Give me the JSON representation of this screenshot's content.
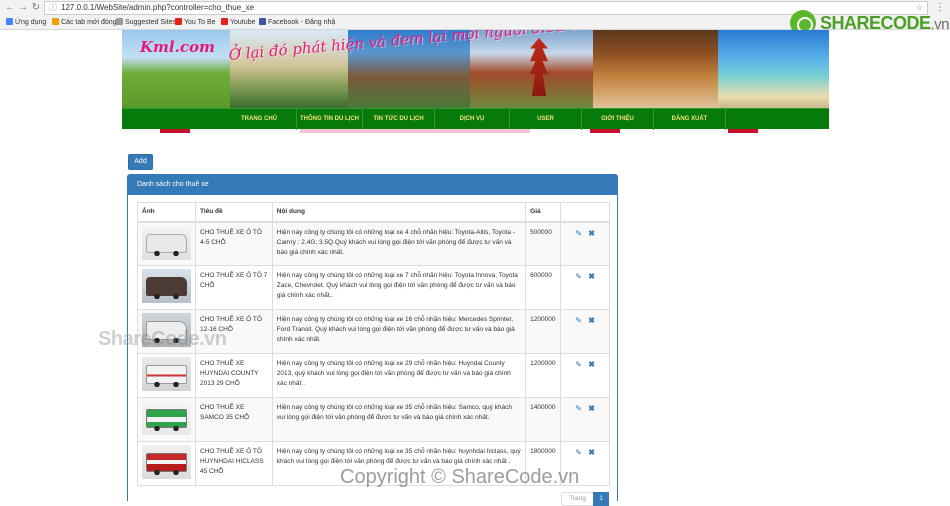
{
  "browser": {
    "url": "127.0.0.1/WebSite/admin.php?controller=cho_thue_xe",
    "bookmarks": [
      {
        "label": "Ứng dụng",
        "color": "#4285f4"
      },
      {
        "label": "Các tab mới đóng",
        "color": "#f6a000"
      },
      {
        "label": "Suggested Sites",
        "color": "#999999"
      },
      {
        "label": "You To Be",
        "color": "#e62117"
      },
      {
        "label": "Youtube",
        "color": "#e62117"
      },
      {
        "label": "Facebook - Đăng nhậ",
        "color": "#3b5998"
      }
    ]
  },
  "watermark_logo": {
    "brand": "SHARECODE",
    "tld": ".vn"
  },
  "site": {
    "logo": "Kml.com",
    "slogan": "Ở lại đó phát hiện và đem lại mọi người điều thú vị về những nơi nước khác"
  },
  "nav": [
    {
      "label": "TRANG CHỦ"
    },
    {
      "label": "THÔNG TIN DU LỊCH"
    },
    {
      "label": "TIN TỨC DU LỊCH"
    },
    {
      "label": "DỊCH VỤ"
    },
    {
      "label": "USER"
    },
    {
      "label": "GIỚI THIỆU"
    },
    {
      "label": "ĐĂNG XUẤT"
    }
  ],
  "add_button": "Add",
  "panel_title": "Danh sách cho thuê xe",
  "table": {
    "headers": [
      "Ảnh",
      "Tiêu đề",
      "Nội dung",
      "Giá",
      ""
    ],
    "rows": [
      {
        "title": "CHO THUÊ XE Ô TÔ 4-5 CHỖ",
        "content": "Hiện nay công ty chúng tôi có những loại xe 4 chỗ nhãn hiệu: Toyota-Altis, Toyota - Camry : 2.4G; 3.5Q.Quý khách vui lòng gọi điện tới văn phòng để được tư vấn và báo giá chính xác nhất.",
        "price": "500000"
      },
      {
        "title": "CHO THUÊ XE Ô TÔ 7 CHỖ",
        "content": "Hiện nay công ty chúng tôi có những loại xe 7 chỗ nhãn hiệu: Toyota Innova, Toyota Zace, Chevrolet. Quý khách vui lòng gọi điện tới văn phòng để được tư vấn và báo giá chính xác nhất..",
        "price": "600000"
      },
      {
        "title": "CHO THUÊ XE Ô TÔ 12-16 CHỖ",
        "content": "Hiện nay công ty chúng tôi có những loại xe 16 chỗ nhãn hiệu: Mercedes Sprinter, Ford Transit. Quý khách vui lòng gọi điện tới văn phòng để được tư vấn và báo giá chính xác nhất.",
        "price": "1200000"
      },
      {
        "title": "CHO THUÊ XE HUYNDAI COUNTY 2013 29 CHỖ",
        "content": "Hiện nay công ty chúng tôi có những loại xe 29 chỗ nhãn hiệu: Huyndai County 2013, quý khách vui lòng gọi điện tới văn phòng để được tư vấn và báo giá chính xác nhất .",
        "price": "1200000"
      },
      {
        "title": "CHO THUÊ XE SAMCO 35 CHỖ",
        "content": "Hiện nay công ty chúng tôi có những loại xe 35 chỗ nhãn hiệu: Samco, quý khách vui lòng gọi điện tới văn phòng để được tư vấn và báo giá chính xác nhất.",
        "price": "1400000"
      },
      {
        "title": "CHO THUÊ XE Ô TÔ HUYNHDAI HICLASS 45 CHỖ",
        "content": "Hiện nay công ty chúng tôi có những loại xe 35 chỗ nhãn hiệu: huynhdai hiclass, quý khách vui lòng gọi điện tới văn phòng để được tư vấn và báo giá chính xác nhất .",
        "price": "1800000"
      }
    ]
  },
  "pagination": {
    "prev": "Trang",
    "current": "1"
  },
  "watermark_mid": "ShareCode.vn",
  "watermark_bottom": "Copyright © ShareCode.vn"
}
